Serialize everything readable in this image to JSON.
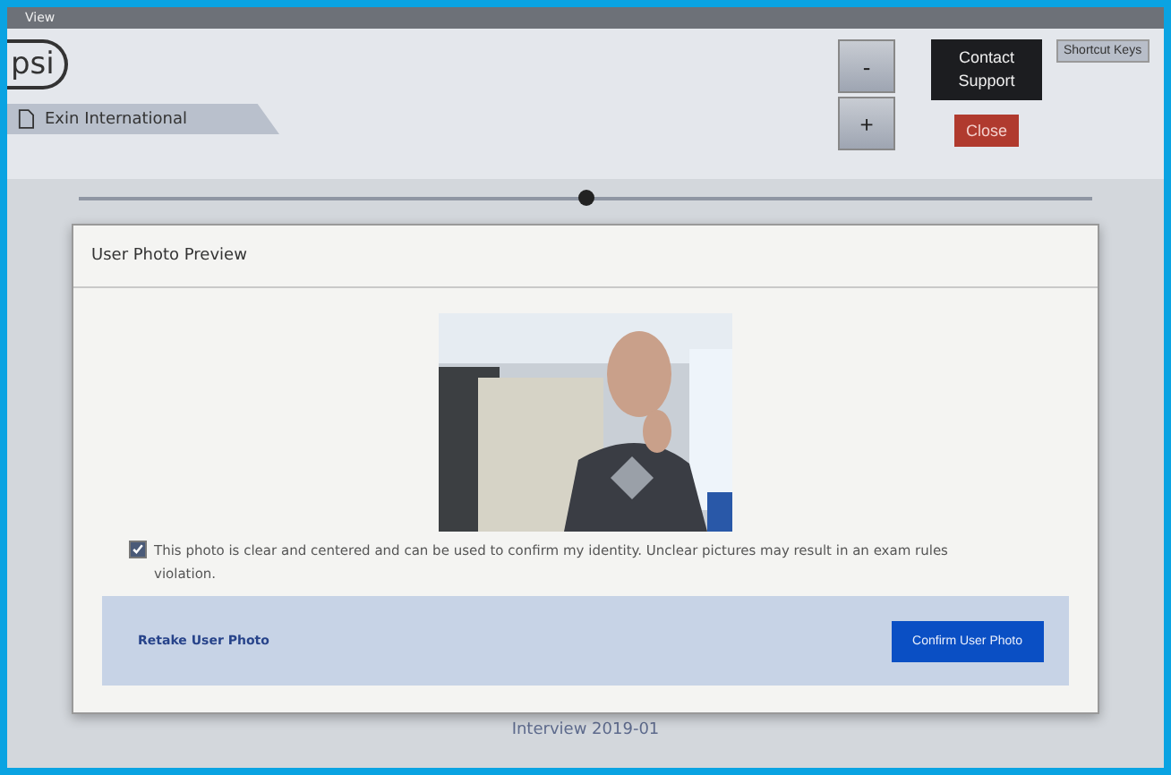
{
  "menu_bar": {
    "items": [
      "View"
    ]
  },
  "header": {
    "logo": "psi",
    "tab": {
      "label": "Exin International",
      "selected": true
    },
    "zoom_out": "-",
    "zoom_in": "+",
    "contact_support": "Contact Support",
    "close": "Close",
    "shortcut_keys": "Shortcut Keys"
  },
  "slider": {
    "level": 0.5
  },
  "dialog": {
    "title": "User Photo Preview",
    "consent": {
      "checked": true,
      "text": "This photo is clear and centered and can be used to confirm my identity. Unclear pictures may result in an exam rules violation."
    },
    "retake": "Retake User Photo",
    "confirm": "Confirm User Photo"
  },
  "footer_text": "Interview 2019-01"
}
